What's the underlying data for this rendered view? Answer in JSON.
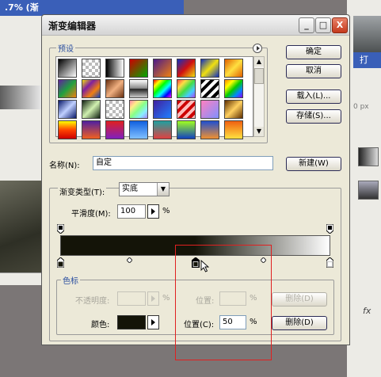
{
  "background": {
    "doc_title": ".7% (渐",
    "right_title": "打",
    "right_field": "0 px",
    "right_fx": "fx"
  },
  "dialog": {
    "title": "渐变编辑器",
    "window_buttons": {
      "minimize": "_",
      "maximize": "□",
      "close": "X"
    },
    "presets_label": "预设",
    "presets_menu_icon": "right-arrow-circle-icon",
    "scroll_up": "▲",
    "scroll_down": "▼",
    "buttons": {
      "ok": "确定",
      "cancel": "取消",
      "load": "载入(L)...",
      "save": "存储(S)...",
      "new": "新建(W)"
    },
    "name_label": "名称(N):",
    "name_value": "自定",
    "gradient_type_label": "渐变类型(T):",
    "gradient_type_value": "实底",
    "smoothness_label": "平滑度(M):",
    "smoothness_value": "100",
    "smoothness_unit": "%",
    "stops_label": "色标",
    "opacity_label": "不透明度:",
    "opacity_unit": "%",
    "opacity_location_label": "位置:",
    "opacity_location_unit": "%",
    "opacity_delete": "删除(D)",
    "color_label": "颜色:",
    "color_value": "#141408",
    "color_location_label": "位置(C):",
    "color_location_value": "50",
    "color_location_unit": "%",
    "color_delete": "删除(D)",
    "gradient_start_color": "#141408",
    "gradient_end_color": "#ffffff",
    "color_stop_location_percent": 50,
    "highlight_color": "#e02020"
  },
  "presets": [
    {
      "name": "foreground-to-background",
      "css": "linear-gradient(135deg,#000,#fff)"
    },
    {
      "name": "foreground-to-transparent",
      "css": "repeating-conic-gradient(#bbb 0 25%,#fff 0 50%) 0 0/8px 8px"
    },
    {
      "name": "black-white",
      "css": "linear-gradient(90deg,#000,#fff)"
    },
    {
      "name": "red-green",
      "css": "linear-gradient(135deg,#c00,#0a0)"
    },
    {
      "name": "violet-orange",
      "css": "linear-gradient(135deg,#4a1a8a,#f08010)"
    },
    {
      "name": "blue-red-yellow",
      "css": "linear-gradient(135deg,#1030c0,#d01010,#f0e010)"
    },
    {
      "name": "blue-yellow-blue",
      "css": "linear-gradient(135deg,#1030c0,#f0e010,#1030c0)"
    },
    {
      "name": "orange-yellow-orange",
      "css": "linear-gradient(135deg,#e06000,#ffe040,#e06000)"
    },
    {
      "name": "violet-green-orange",
      "css": "linear-gradient(135deg,#6020a0,#20a040,#f08010)"
    },
    {
      "name": "yellow-violet-orange-blue",
      "css": "linear-gradient(135deg,#f0e010,#8020a0,#f08010,#1040c0)"
    },
    {
      "name": "copper",
      "css": "linear-gradient(135deg,#6a3010,#f0b080,#6a3010)"
    },
    {
      "name": "chrome",
      "css": "linear-gradient(180deg,#fff,#888 48%,#222 52%,#ccc)"
    },
    {
      "name": "spectrum",
      "css": "linear-gradient(135deg,#f00,#ff0,#0f0,#0ff,#00f,#f0f)"
    },
    {
      "name": "transparent-rainbow",
      "css": "linear-gradient(135deg,#f44,#fd4,#4d4,#4cf,#a4f)"
    },
    {
      "name": "transparent-stripes",
      "css": "repeating-linear-gradient(135deg,#000 0 4px,#fff 4px 8px)"
    },
    {
      "name": "rainbow-2",
      "css": "linear-gradient(135deg,#f80,#ff0,#0c0,#08f,#80f)"
    },
    {
      "name": "blue-metal",
      "css": "linear-gradient(135deg,#0a1a6a,#c0d0ff,#0a1a6a)"
    },
    {
      "name": "green-metal",
      "css": "linear-gradient(135deg,#102010,#d0f0b0,#102010)"
    },
    {
      "name": "checker",
      "css": "repeating-conic-gradient(#bbb 0 25%,#fff 0 50%) 0 0/8px 8px"
    },
    {
      "name": "pastel-rainbow",
      "css": "linear-gradient(135deg,#f8a,#fe8,#8f8,#8ef,#a8f)"
    },
    {
      "name": "violet-blue",
      "css": "linear-gradient(135deg,#4020a0,#2080ff)"
    },
    {
      "name": "red-stripes",
      "css": "repeating-linear-gradient(135deg,#c00 0 4px,#fbb 4px 8px)"
    },
    {
      "name": "pink-blue",
      "css": "linear-gradient(135deg,#ff80c0,#8090ff)"
    },
    {
      "name": "gold",
      "css": "linear-gradient(135deg,#603000,#ffd060,#603000)"
    },
    {
      "name": "yellow-red",
      "css": "linear-gradient(180deg,#ff0,#f40,#c00)"
    },
    {
      "name": "purple-orange",
      "css": "linear-gradient(180deg,#5020a0,#f06020)"
    },
    {
      "name": "red-violet",
      "css": "linear-gradient(180deg,#e02020,#8020c0)"
    },
    {
      "name": "sky-blue",
      "css": "linear-gradient(180deg,#1060e0,#80c0ff)"
    },
    {
      "name": "teal-red",
      "css": "linear-gradient(180deg,#20a0a0,#e04040)"
    },
    {
      "name": "lime-blue",
      "css": "linear-gradient(180deg,#a0ff20,#1040c0)"
    },
    {
      "name": "blue-orange",
      "css": "linear-gradient(180deg,#2050d0,#f09030)"
    },
    {
      "name": "orange-yellow",
      "css": "linear-gradient(180deg,#f06010,#ffe040)"
    }
  ]
}
